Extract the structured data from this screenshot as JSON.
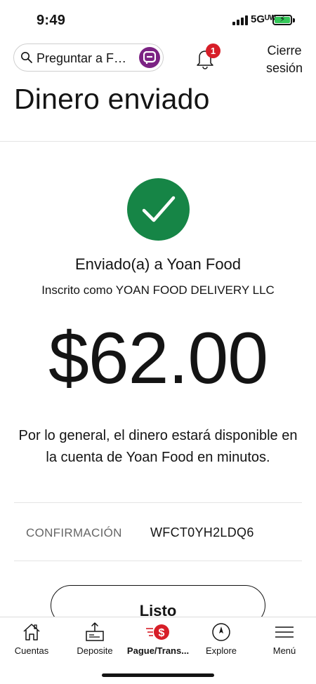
{
  "status_bar": {
    "time": "9:49",
    "network": "5Gᵁᵂ",
    "battery_color": "#35c759"
  },
  "header": {
    "search_placeholder": "Preguntar a F…",
    "notification_count": "1",
    "signout_line1": "Cierre",
    "signout_line2": "sesión",
    "icons": [
      "search-icon",
      "assistant-icon",
      "bell-icon"
    ]
  },
  "page": {
    "title": "Dinero enviado"
  },
  "confirmation": {
    "sent_to": "Enviado(a) a Yoan Food",
    "enrolled_as": "Inscrito como YOAN FOOD DELIVERY LLC",
    "amount": "$62.00",
    "availability_message": "Por lo general, el dinero estará disponible en la cuenta de Yoan Food en minutos.",
    "confirmation_label": "CONFIRMACIÓN",
    "confirmation_number": "WFCT0YH2LDQ6",
    "done_button": "Listo",
    "success_color": "#168546"
  },
  "bottom_nav": {
    "items": [
      {
        "label": "Cuentas",
        "icon": "home-icon"
      },
      {
        "label": "Deposite",
        "icon": "deposit-icon"
      },
      {
        "label": "Pague/Trans...",
        "icon": "pay-transfer-icon",
        "active": true
      },
      {
        "label": "Explore",
        "icon": "compass-icon"
      },
      {
        "label": "Menú",
        "icon": "menu-icon"
      }
    ],
    "accent_color": "#d71e28"
  }
}
